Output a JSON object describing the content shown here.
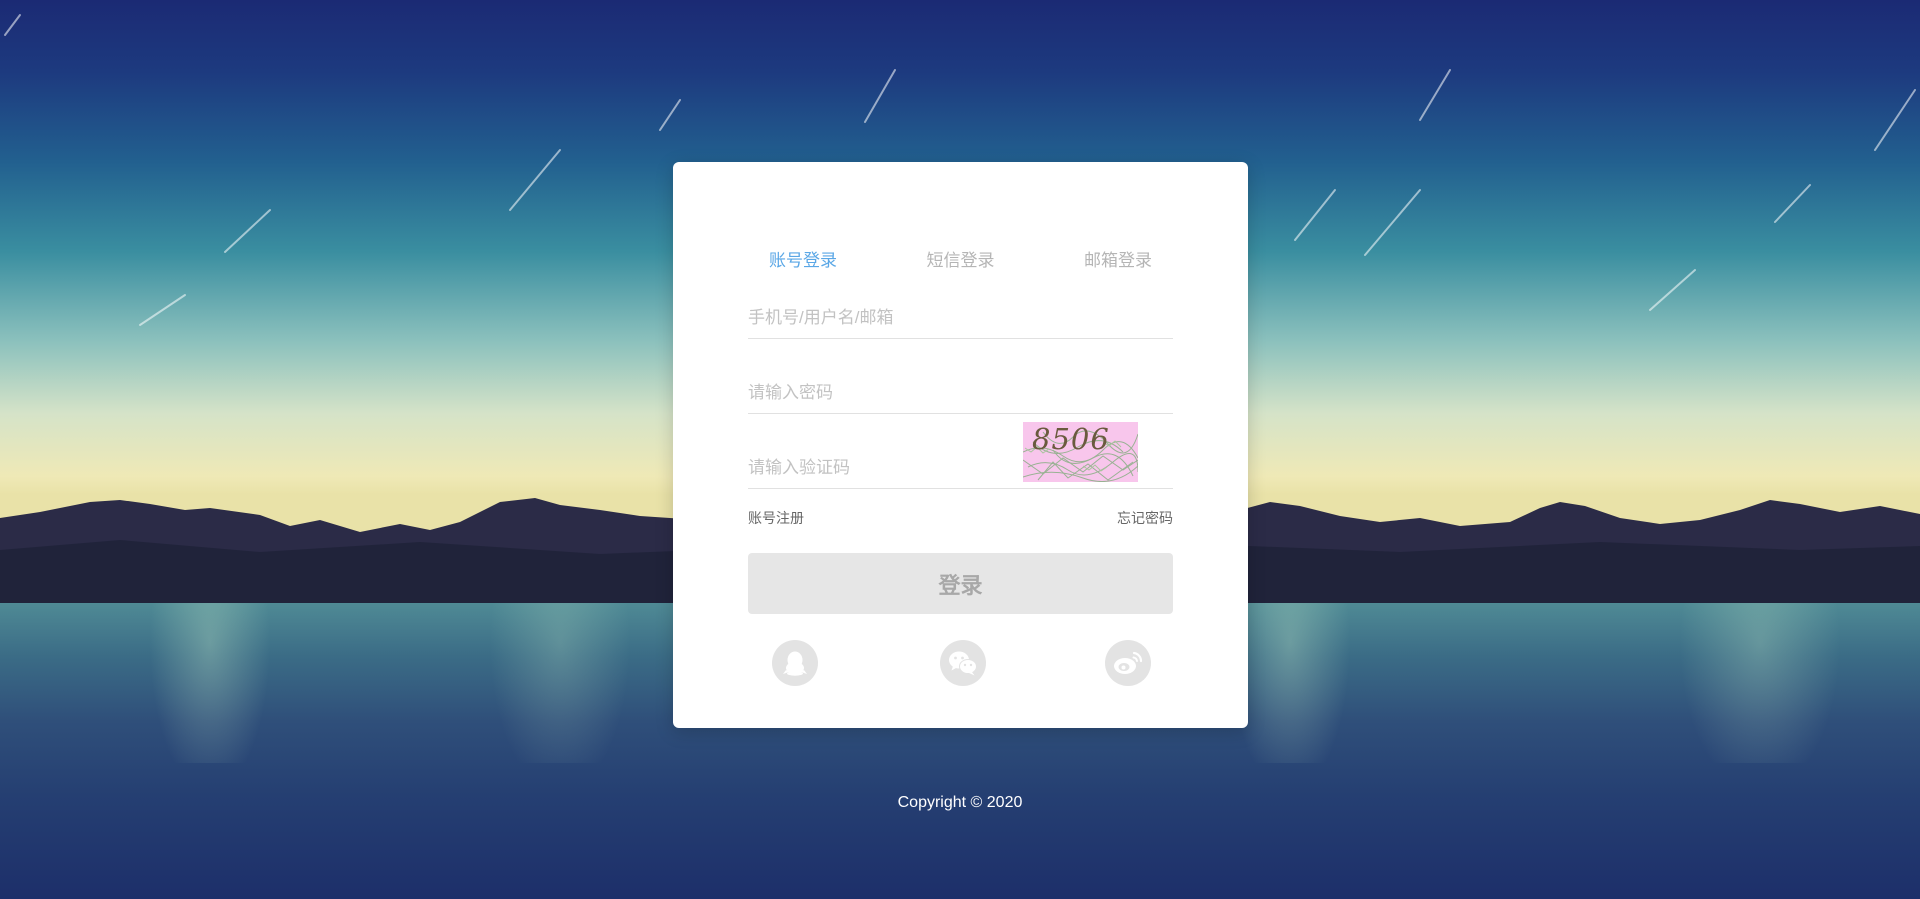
{
  "login": {
    "tabs": [
      {
        "label": "账号登录",
        "active": true
      },
      {
        "label": "短信登录",
        "active": false
      },
      {
        "label": "邮箱登录",
        "active": false
      }
    ],
    "username_placeholder": "手机号/用户名/邮箱",
    "password_placeholder": "请输入密码",
    "captcha_placeholder": "请输入验证码",
    "captcha_text": "8506",
    "register_link": "账号注册",
    "forgot_link": "忘记密码",
    "submit_label": "登录",
    "social": [
      {
        "icon": "qq-icon"
      },
      {
        "icon": "wechat-icon"
      },
      {
        "icon": "weibo-icon"
      }
    ]
  },
  "footer": {
    "copyright": "Copyright © 2020"
  },
  "colors": {
    "accent": "#5aa7e6",
    "muted_text": "#b5b5b5",
    "button_bg": "#e6e6e6",
    "captcha_bg": "#f8c6ec"
  }
}
